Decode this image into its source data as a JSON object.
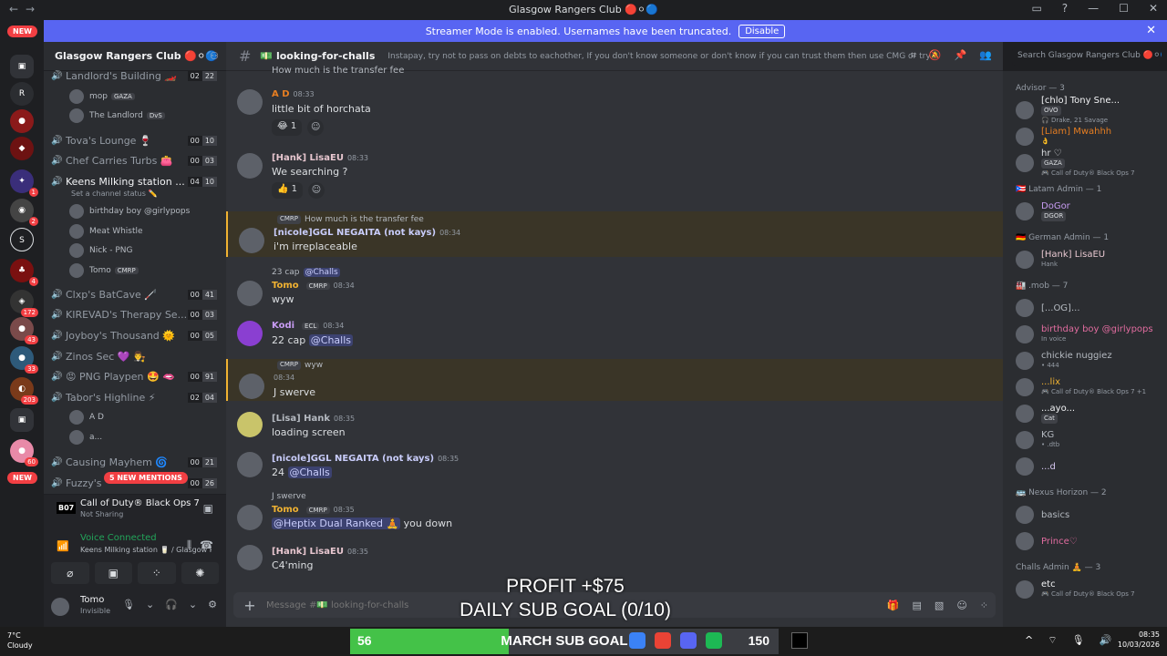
{
  "window": {
    "title": "Glasgow Rangers Club 🔴⚪🔵"
  },
  "banner": {
    "text": "Streamer Mode is enabled. Usernames have been truncated.",
    "button": "Disable"
  },
  "servers": {
    "badges": [
      "NEW",
      "1",
      "2",
      "4",
      "172",
      "43",
      "33",
      "203",
      "60",
      "NEW"
    ]
  },
  "sidebar": {
    "server_name": "Glasgow Rangers Club 🔴⚪🔵",
    "channels": [
      {
        "name": "Landlord's Building 🏎️",
        "a": "02",
        "b": "22"
      },
      {
        "name": "Tova's Lounge 🍷",
        "a": "00",
        "b": "10"
      },
      {
        "name": "Chef Carries Turbs 👛",
        "a": "00",
        "b": "03"
      },
      {
        "name": "Keens Milking station ...",
        "a": "04",
        "b": "10",
        "sub": "Set a channel status ✏️"
      },
      {
        "name": "Clxp's BatCave 🦯",
        "a": "00",
        "b": "41"
      },
      {
        "name": "KIREVAD's Therapy Se...",
        "a": "00",
        "b": "03"
      },
      {
        "name": "Joyboy's Thousand 🌞",
        "a": "00",
        "b": "05"
      },
      {
        "name": "Zinos Sec 💜 👨‍⚖️",
        "a": "",
        "b": ""
      },
      {
        "name": "😡 PNG Playpen 🤩 🫦",
        "a": "00",
        "b": "91"
      },
      {
        "name": "Tabor's Highline ⚡",
        "a": "02",
        "b": "04"
      },
      {
        "name": "Causing Mayhem 🌀",
        "a": "00",
        "b": "21"
      },
      {
        "name": "Fuzzy's",
        "a": "00",
        "b": "26"
      }
    ],
    "voice_users_landlord": [
      {
        "name": "mop",
        "tag": "GAZA"
      },
      {
        "name": "The Landlord",
        "tag": "DvS"
      }
    ],
    "voice_users_keens": [
      {
        "name": "birthday boy @girlypops"
      },
      {
        "name": "Meat Whistle"
      },
      {
        "name": "Nick - PNG"
      },
      {
        "name": "Tomo",
        "tag": "CMRP"
      }
    ],
    "voice_users_tabor": [
      {
        "name": "A D"
      },
      {
        "name": "a..."
      }
    ],
    "new_mentions": "5 NEW MENTIONS"
  },
  "activity": {
    "game": "Call of Duty® Black Ops 7",
    "status": "Not Sharing"
  },
  "voice": {
    "status": "Voice Connected",
    "channel": "Keens Milking station 🥛 / Glasgow Ran..."
  },
  "user": {
    "name": "Tomo",
    "status": "Invisible"
  },
  "chat": {
    "channel": "looking-for-challs",
    "topic": "Instapay, try not to pass on debts to eachother, If you don't know someone or don't know if you can trust them then use CMG or try to get a middle m...",
    "search_placeholder": "Search Glasgow Rangers Club 🔴⚪🔵",
    "top_cut": "How much is the transfer fee",
    "messages": [
      {
        "author": "A D",
        "time": "08:33",
        "text": "little bit of horchata",
        "reaction": "😂 1"
      },
      {
        "author": "[Hank] LisaEU",
        "time": "08:33",
        "text": "We searching ?",
        "reaction": "👍 1"
      },
      {
        "author": "[nicole]GGL NEGAITA (not kays)",
        "time": "08:34",
        "text": "i'm irreplaceable",
        "reply": "How much is the transfer fee",
        "reply_tag": "CMRP"
      },
      {
        "author": "Tomo",
        "tag": "CMRP",
        "time": "08:34",
        "text": "wyw",
        "reply": "23 cap",
        "reply_mention": "@Challs"
      },
      {
        "author": "Kodi",
        "tag": "ECL",
        "time": "08:34",
        "text": "22 cap",
        "mention": "@Challs"
      },
      {
        "author": "",
        "time": "08:34",
        "text": "J swerve",
        "reply": "wyw",
        "reply_tag": "CMRP"
      },
      {
        "author": "[Lisa] Hank",
        "time": "08:35",
        "text": "loading screen"
      },
      {
        "author": "[nicole]GGL NEGAITA (not kays)",
        "time": "08:35",
        "text": "24",
        "mention": "@Challs"
      },
      {
        "author": "Tomo",
        "tag": "CMRP",
        "time": "08:35",
        "text": "you down",
        "reply": "J swerve",
        "mention": "@Heptix Dual Ranked 🧘"
      },
      {
        "author": "[Hank] LisaEU",
        "time": "08:35",
        "text": "C4'ming"
      }
    ],
    "composer_placeholder": "Message #💵 looking-for-challs"
  },
  "overlay": {
    "profit": "PROFIT +$75",
    "sub_goal": "DAILY SUB GOAL (0/10)"
  },
  "members": {
    "groups": [
      {
        "title": "Advisor — 3",
        "items": [
          {
            "name": "[chlo] Tony Sne...",
            "tag": "OVO",
            "st": "🎧 Drake, 21 Savage"
          },
          {
            "name": "[Liam] Mwahhh",
            "st": "👌"
          },
          {
            "name": "hr ♡",
            "tag": "GAZA",
            "st": "🎮 Call of Duty® Black Ops 7"
          }
        ]
      },
      {
        "title": "🇵🇷 Latam Admin — 1",
        "items": [
          {
            "name": "DoGor",
            "tag": "DGOR"
          }
        ]
      },
      {
        "title": "🇩🇪 German Admin — 1",
        "items": [
          {
            "name": "[Hank] LisaEU",
            "st": "Hank"
          }
        ]
      },
      {
        "title": "🏭 .mob — 7",
        "items": [
          {
            "name": "[...OG]..."
          },
          {
            "name": "birthday boy @girlypops",
            "st": "In voice"
          },
          {
            "name": "chickie nuggiez",
            "st": "• 444"
          },
          {
            "name": "...lix",
            "st": "🎮 Call of Duty® Black Ops 7 +1"
          },
          {
            "name": "...ayo...",
            "tag": "Cat"
          },
          {
            "name": "KG",
            "st": "• .dtb"
          },
          {
            "name": "...d"
          }
        ]
      },
      {
        "title": "🚌 Nexus Horizon — 2",
        "items": [
          {
            "name": "basics"
          },
          {
            "name": "Prince♡"
          }
        ]
      },
      {
        "title": "Challs Admin 🧘 — 3",
        "items": [
          {
            "name": "etc",
            "st": "🎮 Call of Duty® Black Ops 7"
          }
        ]
      }
    ]
  },
  "taskbar": {
    "weather_temp": "7°C",
    "weather_desc": "Cloudy",
    "goal_left": "56",
    "goal_title": "MARCH SUB GOAL",
    "goal_right": "150",
    "goal_progress": 0.37,
    "time": "08:35",
    "date": "10/03/2026"
  }
}
